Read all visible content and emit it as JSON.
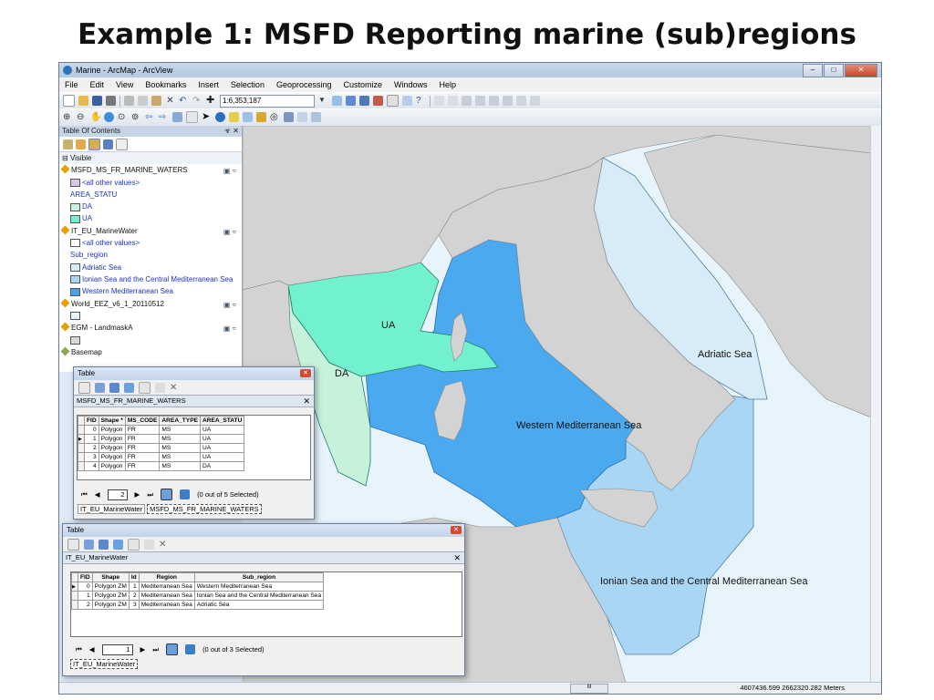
{
  "slide": {
    "title": "Example 1: MSFD Reporting marine (sub)regions"
  },
  "window": {
    "title": "Marine - ArcMap - ArcView"
  },
  "menu": [
    "File",
    "Edit",
    "View",
    "Bookmarks",
    "Insert",
    "Selection",
    "Geoprocessing",
    "Customize",
    "Windows",
    "Help"
  ],
  "toolbar": {
    "scale": "1:6,353,187"
  },
  "toc": {
    "title": "Table Of Contents",
    "group": "Visible",
    "rows": [
      {
        "kind": "layer",
        "label": "MSFD_MS_FR_MARINE_WATERS"
      },
      {
        "kind": "sub",
        "label": "<all other values>",
        "swatch": "#d9c6ea"
      },
      {
        "kind": "sub",
        "label": "AREA_STATU"
      },
      {
        "kind": "sub",
        "label": "DA",
        "swatch": "#c7f3dc"
      },
      {
        "kind": "sub",
        "label": "UA",
        "swatch": "#71f2cf"
      },
      {
        "kind": "layer",
        "label": "IT_EU_MarineWater"
      },
      {
        "kind": "sub",
        "label": "<all other values>",
        "swatch": "#ffffff"
      },
      {
        "kind": "sub",
        "label": "Sub_region"
      },
      {
        "kind": "sub",
        "label": "Adriatic Sea",
        "swatch": "#d7edf9"
      },
      {
        "kind": "sub",
        "label": "Ionian Sea and the Central Mediterranean Sea",
        "swatch": "#a6d6f5"
      },
      {
        "kind": "sub",
        "label": "Western Mediterranean Sea",
        "swatch": "#3fa3ef"
      },
      {
        "kind": "layer",
        "label": "World_EEZ_v6_1_20110512"
      },
      {
        "kind": "sub",
        "label": "",
        "swatch": "#e6f4fb"
      },
      {
        "kind": "layer",
        "label": "EGM - LandmaskA"
      },
      {
        "kind": "sub",
        "label": "",
        "swatch": "#d8d8d8"
      },
      {
        "kind": "basemap",
        "label": "Basemap"
      }
    ]
  },
  "map": {
    "labels": {
      "ua": "UA",
      "da": "DA",
      "adriatic": "Adriatic Sea",
      "western": "Western Mediterranean Sea",
      "ionian": "Ionian Sea and the Central Mediterranean Sea"
    },
    "colors": {
      "land": "#d3d3d3",
      "western": "#4aa9ef",
      "ionian": "#a9d6f4",
      "adriatic": "#d8ecf8",
      "eez": "#e7f4fb",
      "ua": "#72f1cf",
      "da": "#c6f2dc"
    }
  },
  "status": {
    "coords": "4607436.599  2662320.282 Meters",
    "scroll_label": "III"
  },
  "table1": {
    "window_title": "Table",
    "layer_name": "MSFD_MS_FR_MARINE_WATERS",
    "columns": [
      "FID",
      "Shape *",
      "MS_CODE",
      "AREA_TYPE",
      "AREA_STATU"
    ],
    "rows": [
      [
        "0",
        "Polygon",
        "FR",
        "MS",
        "UA"
      ],
      [
        "1",
        "Polygon",
        "FR",
        "MS",
        "UA"
      ],
      [
        "2",
        "Polygon",
        "FR",
        "MS",
        "UA"
      ],
      [
        "3",
        "Polygon",
        "FR",
        "MS",
        "UA"
      ],
      [
        "4",
        "Polygon",
        "FR",
        "MS",
        "DA"
      ]
    ],
    "current_record": "2",
    "selected_text": "(0 out of 5 Selected)",
    "tabs": [
      "IT_EU_MarineWater",
      "MSFD_MS_FR_MARINE_WATERS"
    ]
  },
  "table2": {
    "window_title": "Table",
    "layer_name": "IT_EU_MarineWater",
    "columns": [
      "FID",
      "Shape",
      "Id",
      "Region",
      "Sub_region"
    ],
    "rows": [
      [
        "0",
        "Polygon ZM",
        "1",
        "Mediterranean Sea",
        "Western Mediterranean Sea"
      ],
      [
        "1",
        "Polygon ZM",
        "2",
        "Mediterranean Sea",
        "Ionian Sea and the Central Mediterranean Sea"
      ],
      [
        "2",
        "Polygon ZM",
        "3",
        "Mediterranean Sea",
        "Adriatic Sea"
      ]
    ],
    "current_record": "1",
    "selected_text": "(0 out of 3 Selected)",
    "tabs": [
      "IT_EU_MarineWater"
    ]
  }
}
